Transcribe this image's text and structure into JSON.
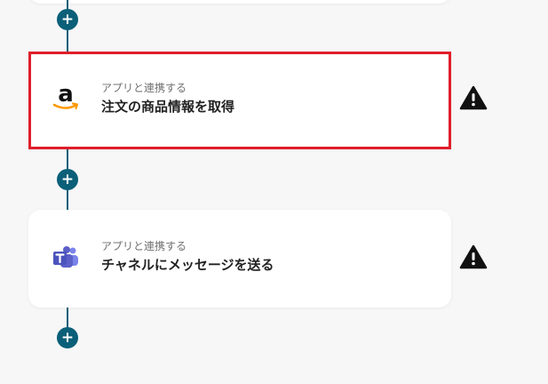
{
  "flow": {
    "steps": [
      {
        "subtitle": "アプリと連携する",
        "title": "注文の商品情報を取得",
        "icon": "amazon-logo-icon",
        "selected": true,
        "status_icon": "warning-icon"
      },
      {
        "subtitle": "アプリと連携する",
        "title": "チャネルにメッセージを送る",
        "icon": "microsoft-teams-icon",
        "selected": false,
        "status_icon": "warning-icon"
      }
    ],
    "add_button_symbol": "+"
  },
  "colors": {
    "connector": "#0b5f78",
    "selection_border": "#e01e2a",
    "teams_purple": "#5b5fc7",
    "amazon_orange": "#ff9900"
  }
}
